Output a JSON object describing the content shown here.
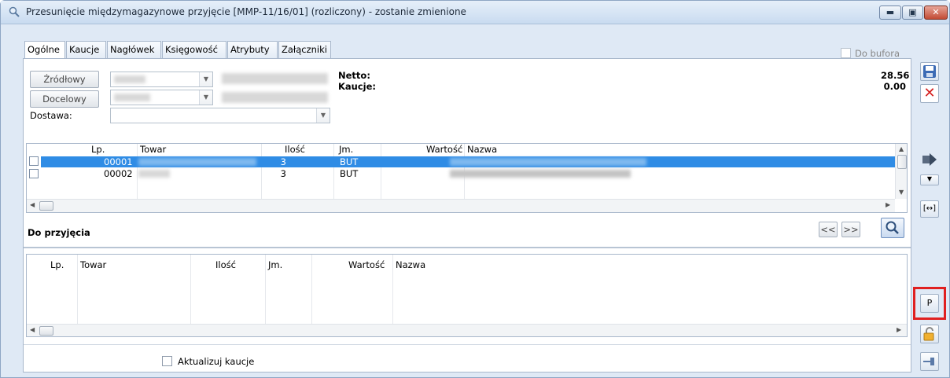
{
  "window": {
    "title": "Przesunięcie międzymagazynowe przyjęcie [MMP-11/16/01] (rozliczony) - zostanie zmienione",
    "controls": [
      "minimize",
      "maximize",
      "close"
    ]
  },
  "tabs": [
    {
      "label": "Ogólne",
      "active": true
    },
    {
      "label": "Kaucje",
      "active": false
    },
    {
      "label": "Nagłówek",
      "active": false
    },
    {
      "label": "Księgowość",
      "active": false
    },
    {
      "label": "Atrybuty",
      "active": false
    },
    {
      "label": "Załączniki",
      "active": false
    }
  ],
  "do_bufora": {
    "label": "Do bufora",
    "checked": false
  },
  "header": {
    "zrodlowy_button": "Źródłowy",
    "docelowy_button": "Docelowy",
    "dostawa_label": "Dostawa:",
    "netto_label": "Netto:",
    "kaucje_label": "Kaucje:",
    "netto_value": "28.56",
    "kaucje_value": "0.00"
  },
  "items_table": {
    "columns": [
      "Lp.",
      "Towar",
      "Ilość",
      "Jm.",
      "Wartość",
      "Nazwa"
    ],
    "rows": [
      {
        "lp": "00001",
        "towar": "",
        "ilosc": "3",
        "jm": "BUT",
        "wartosc": "",
        "nazwa": "",
        "selected": true
      },
      {
        "lp": "00002",
        "towar": "",
        "ilosc": "3",
        "jm": "BUT",
        "wartosc": "",
        "nazwa": "",
        "selected": false
      }
    ]
  },
  "do_przyjecia": {
    "title": "Do przyjęcia",
    "prev_button": "<<",
    "next_button": ">>"
  },
  "pending_table": {
    "columns": [
      "Lp.",
      "Towar",
      "Ilość",
      "Jm.",
      "Wartość",
      "Nazwa"
    ],
    "rows": []
  },
  "aktualizuj_kaucje": {
    "label": "Aktualizuj kaucje",
    "checked": false
  },
  "sidebar": {
    "p_button": "P",
    "p_highlight_color": "#e02020"
  },
  "colors": {
    "selection": "#2f8ce5",
    "window_bg": "#dfe9f5",
    "close_button": "#c24b35"
  }
}
